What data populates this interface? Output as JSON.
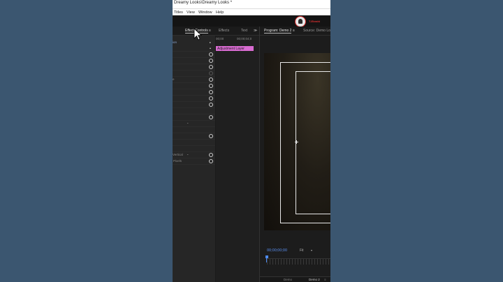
{
  "window": {
    "title": "Dreamy Looks\\Dreamy Looks *"
  },
  "menu": {
    "items": [
      "Titles",
      "View",
      "Window",
      "Help"
    ]
  },
  "logo": {
    "text": "T-Ebrahi"
  },
  "effect_controls": {
    "tabs": [
      "Effect Controls",
      "Effects",
      "Text"
    ],
    "active_tab": "Effect Controls",
    "menu_glyph": "≡",
    "overflow_glyph": "≫",
    "timecode_start": "00;00",
    "timecode_end": "00;00;04;0",
    "clip_label": "Adjustment Layer",
    "partial_labels": {
      "source_frag": "ion",
      "e_frag": "e",
      "vertical": "Vertical",
      "pixels": "Pixels"
    }
  },
  "program_monitor": {
    "tabs": [
      "Program: Demo 2",
      "Source: Demo Lo"
    ],
    "active_tab": "Program: Demo 2",
    "menu_glyph": "≡",
    "timecode": "00;00;00;00",
    "zoom": "Fit",
    "bottom_tabs": [
      "Demo",
      "Demo 2",
      "≡"
    ]
  },
  "colors": {
    "accent": "#4d8af0",
    "clip": "#d86bd1",
    "background": "#3b5670"
  }
}
